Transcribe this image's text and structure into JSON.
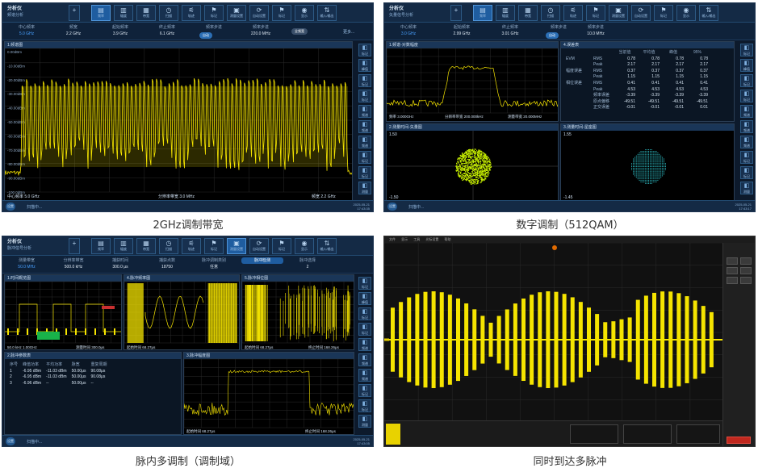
{
  "common": {
    "toolbar_buttons": [
      "频率",
      "幅度",
      "带宽",
      "扫描",
      "轨迹",
      "标记",
      "测量设置",
      "自动设置",
      "标记",
      "显示",
      "输入/输出"
    ],
    "round_button": "设置",
    "status_text": "扫描中...",
    "sidebar_labels": [
      "标记",
      "峰值",
      "标记",
      "标记",
      "频谱",
      "频谱",
      "频谱",
      "标记",
      "标记",
      "测量"
    ]
  },
  "panel1": {
    "caption": "2GHz调制带宽",
    "app_title": "频谱分析",
    "app_sub": "分析仪",
    "params": [
      {
        "label": "中心频率",
        "value": "5.0 GHz"
      },
      {
        "label": "频宽",
        "value": "2.2 GHz"
      },
      {
        "label": "起始频率",
        "value": "3.9 GHz"
      },
      {
        "label": "终止频率",
        "value": "6.1 GHz"
      },
      {
        "label": "频率步进",
        "value": "自动"
      },
      {
        "label": "频率步进",
        "value": "220.0 MHz"
      }
    ],
    "full_span_btn": "全频宽",
    "more_label": "更多...",
    "plot_title": "1.频谱图",
    "y_ticks": [
      "0.00dBm",
      "-10.00dBm",
      "-20.00dBm",
      "-30.00dBm",
      "-40.00dBm",
      "-50.00dBm",
      "-60.00dBm",
      "-70.00dBm",
      "-80.00dBm",
      "-90.00dBm",
      "-100.0dBm"
    ],
    "foot_left": "中心频率 5.0 GHz",
    "foot_mid": "分辨率带宽 3.0 MHz",
    "foot_right": "频宽 2.2 GHz",
    "time": "2025-05-21",
    "time2": "17:43:35"
  },
  "panel2": {
    "caption": "数字调制（512QAM）",
    "app_title": "矢量信号分析",
    "app_sub": "分析仪",
    "params": [
      {
        "label": "中心频率",
        "value": "3.0 GHz"
      },
      {
        "label": "起始频率",
        "value": "2.99 GHz"
      },
      {
        "label": "终止频率",
        "value": "3.01 GHz"
      },
      {
        "label": "频率步进",
        "value": "自动"
      },
      {
        "label": "频率步进",
        "value": "10.0 MHz"
      }
    ],
    "spec_title": "1.频谱-对数幅度",
    "spec_foot_left": "频率 3.000GHz",
    "spec_foot_mid": "分辨率带宽 200.000kHz",
    "spec_foot_right": "测量带宽 20.000MHz",
    "err_title": "4.误差表",
    "err_headers": [
      "",
      "",
      "当前值",
      "平均值",
      "峰值",
      "95%"
    ],
    "err_rows": [
      [
        "EVM",
        "RMS",
        "0.78",
        "0.78",
        "0.78",
        "0.78"
      ],
      [
        "",
        "Peak",
        "2.17",
        "2.17",
        "2.17",
        "2.17"
      ],
      [
        "幅度误差",
        "RMS",
        "0.37",
        "0.37",
        "0.37",
        "0.37"
      ],
      [
        "",
        "Peak",
        "1.15",
        "1.15",
        "1.15",
        "1.15"
      ],
      [
        "相位误差",
        "RMS",
        "0.41",
        "0.41",
        "0.41",
        "0.41"
      ],
      [
        "",
        "Peak",
        "4.53",
        "4.53",
        "4.53",
        "4.53"
      ],
      [
        "",
        "频率误差",
        "-3.39",
        "-3.39",
        "-3.39",
        "-3.39"
      ],
      [
        "",
        "原点偏移",
        "-49.51",
        "-49.51",
        "-49.51",
        "-49.51"
      ],
      [
        "",
        "正交误差",
        "-0.01",
        "-0.01",
        "-0.01",
        "0.01"
      ]
    ],
    "vec_title": "2.测量时间-矢量图",
    "vec_top": "1.50",
    "vec_bot": "-1.50",
    "const_title": "3.测量时间-星座图",
    "const_top": "1.55",
    "const_bot": "-1.45",
    "time": "2025-05-21",
    "time2": "17:43:17"
  },
  "panel3": {
    "caption": "脉内多调制（调制域）",
    "app_title": "脉冲信号分析",
    "app_sub": "分析仪",
    "params": [
      {
        "label": "测量带宽",
        "value": "50.0 MHz"
      },
      {
        "label": "分辨率带宽",
        "value": "500.0 kHz"
      },
      {
        "label": "捕获时间",
        "value": "300.0 μs"
      },
      {
        "label": "捕获点数",
        "value": "18750"
      },
      {
        "label": "脉冲调制类别",
        "value": "任意"
      },
      {
        "label": "脉冲检测",
        "value": ""
      },
      {
        "label": "脉冲选择",
        "value": "2"
      }
    ],
    "p1_title": "1.时间概览图",
    "p1_foot_left": "50.0 kHz  1.00GHz",
    "p1_foot_right": "测量时间 300.0μs",
    "p4_title": "4.脉冲频率图",
    "p4_foot": "起始时间 68.27μs",
    "p5_title": "5.脉冲相位图",
    "p5_foot_l": "起始时间 68.27μs",
    "p5_foot_r": "终止时间 168.26μs",
    "p2_title": "2.脉冲参数表",
    "list_headers": [
      "序号",
      "峰值功率",
      "平均功率",
      "脉宽",
      "重复周期"
    ],
    "list_rows": [
      [
        "1",
        "-6.95 dBm",
        "-11.03 dBm",
        "50.00μs",
        "90.08μs"
      ],
      [
        "2",
        "-6.95 dBm",
        "-11.03 dBm",
        "50.00μs",
        "90.08μs"
      ],
      [
        "3",
        "-6.96 dBm",
        "--",
        "50.00μs",
        "--"
      ]
    ],
    "p3_title": "3.脉冲幅度图",
    "p3_foot_l": "起始时间 68.27μs",
    "p3_foot_r": "终止时间 168.26μs",
    "time": "2025-05-21",
    "time2": "17:43:05"
  },
  "panel4": {
    "caption": "同时到达多脉冲",
    "menu": [
      "文件",
      "显示",
      "工具",
      "光标设置",
      "帮助"
    ]
  }
}
